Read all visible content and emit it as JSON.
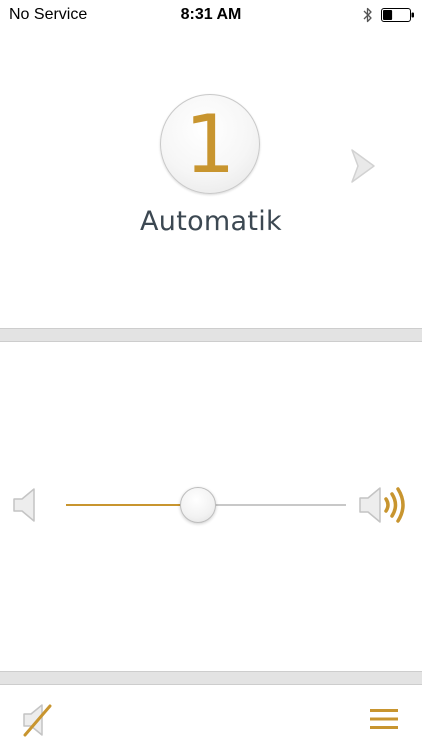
{
  "status_bar": {
    "carrier": "No Service",
    "time": "8:31 AM",
    "bluetooth_icon": "bluetooth-icon",
    "battery_icon": "battery-icon",
    "battery_level": 0.35
  },
  "program": {
    "number": "1",
    "name": "Automatik",
    "next_icon": "chevron-right-icon"
  },
  "volume": {
    "level": 0.47,
    "down_icon": "speaker-quiet-icon",
    "up_icon": "speaker-loud-icon"
  },
  "bottom_bar": {
    "mute_icon": "speaker-mute-icon",
    "menu_icon": "hamburger-menu-icon"
  },
  "colors": {
    "accent": "#c8952f",
    "label": "#3c4852",
    "divider": "#e3e3e3",
    "icon_gray": "#cfcfcf"
  }
}
